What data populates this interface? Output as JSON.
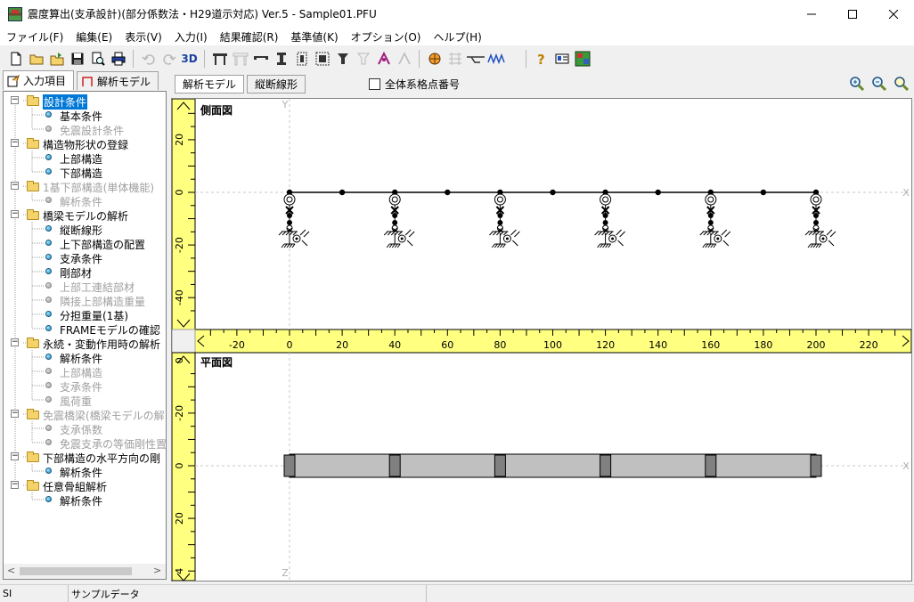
{
  "window": {
    "title": "震度算出(支承設計)(部分係数法・H29道示対応) Ver.5 - Sample01.PFU",
    "minimize_icon": "minimize-icon",
    "maximize_icon": "maximize-icon",
    "close_icon": "close-icon"
  },
  "menu": [
    {
      "label": "ファイル(F)"
    },
    {
      "label": "編集(E)"
    },
    {
      "label": "表示(V)"
    },
    {
      "label": "入力(I)"
    },
    {
      "label": "結果確認(R)"
    },
    {
      "label": "基準値(K)"
    },
    {
      "label": "オプション(O)"
    },
    {
      "label": "ヘルプ(H)"
    }
  ],
  "toolbar": {
    "view3d_label": "3D",
    "icons": [
      "new-file-icon",
      "open-folder-icon",
      "open-sample-icon",
      "save-icon",
      "print-preview-icon",
      "print-icon",
      "undo-icon",
      "redo-icon",
      "bridge-frame-icon",
      "bridge-frame-2-icon",
      "girder-icon",
      "pier-icon",
      "pier-2-icon",
      "bearing-icon",
      "bearing-2-icon",
      "column-icon",
      "column-2-icon",
      "crane-icon",
      "crane-2-icon",
      "calc-icon",
      "grid-icon",
      "level-icon",
      "spring-icon",
      "help-icon",
      "id-card-icon",
      "map-icon"
    ]
  },
  "left_tabs": [
    {
      "label": "入力項目",
      "icon": "input-items-icon",
      "active": true
    },
    {
      "label": "解析モデル",
      "icon": "analysis-model-icon",
      "active": false
    }
  ],
  "tree": [
    {
      "level": 0,
      "label": "設計条件",
      "type": "folder",
      "enabled": true,
      "selected": true
    },
    {
      "level": 1,
      "label": "基本条件",
      "type": "item",
      "enabled": true
    },
    {
      "level": 1,
      "label": "免震設計条件",
      "type": "item",
      "enabled": false
    },
    {
      "level": 0,
      "label": "構造物形状の登録",
      "type": "folder",
      "enabled": true
    },
    {
      "level": 1,
      "label": "上部構造",
      "type": "item",
      "enabled": true
    },
    {
      "level": 1,
      "label": "下部構造",
      "type": "item",
      "enabled": true
    },
    {
      "level": 0,
      "label": "1基下部構造(単体機能)",
      "type": "folder",
      "enabled": false
    },
    {
      "level": 1,
      "label": "解析条件",
      "type": "item",
      "enabled": false
    },
    {
      "level": 0,
      "label": "橋梁モデルの解析",
      "type": "folder",
      "enabled": true
    },
    {
      "level": 1,
      "label": "縦断線形",
      "type": "item",
      "enabled": true
    },
    {
      "level": 1,
      "label": "上下部構造の配置",
      "type": "item",
      "enabled": true
    },
    {
      "level": 1,
      "label": "支承条件",
      "type": "item",
      "enabled": true
    },
    {
      "level": 1,
      "label": "剛部材",
      "type": "item",
      "enabled": true
    },
    {
      "level": 1,
      "label": "上部工連結部材",
      "type": "item",
      "enabled": false
    },
    {
      "level": 1,
      "label": "隣接上部構造重量",
      "type": "item",
      "enabled": false
    },
    {
      "level": 1,
      "label": "分担重量(1基)",
      "type": "item",
      "enabled": true
    },
    {
      "level": 1,
      "label": "FRAMEモデルの確認",
      "type": "item",
      "enabled": true
    },
    {
      "level": 0,
      "label": "永続・変動作用時の解析",
      "type": "folder",
      "enabled": true
    },
    {
      "level": 1,
      "label": "解析条件",
      "type": "item",
      "enabled": true
    },
    {
      "level": 1,
      "label": "上部構造",
      "type": "item",
      "enabled": false
    },
    {
      "level": 1,
      "label": "支承条件",
      "type": "item",
      "enabled": false
    },
    {
      "level": 1,
      "label": "風荷重",
      "type": "item",
      "enabled": false
    },
    {
      "level": 0,
      "label": "免震橋梁(橋梁モデルの解",
      "type": "folder",
      "enabled": false
    },
    {
      "level": 1,
      "label": "支承係数",
      "type": "item",
      "enabled": false
    },
    {
      "level": 1,
      "label": "免震支承の等価剛性置",
      "type": "item",
      "enabled": false
    },
    {
      "level": 0,
      "label": "下部構造の水平方向の剛",
      "type": "folder",
      "enabled": true
    },
    {
      "level": 1,
      "label": "解析条件",
      "type": "item",
      "enabled": true
    },
    {
      "level": 0,
      "label": "任意骨組解析",
      "type": "folder",
      "enabled": true
    },
    {
      "level": 1,
      "label": "解析条件",
      "type": "item",
      "enabled": true
    }
  ],
  "right_tabs": [
    {
      "label": "解析モデル",
      "active": true
    },
    {
      "label": "縦断線形",
      "active": false
    }
  ],
  "checkbox": {
    "label": "全体系格点番号",
    "checked": false
  },
  "zoom_icons": [
    "zoom-in-icon",
    "zoom-out-icon",
    "zoom-fit-icon"
  ],
  "side_view": {
    "title": "側面図",
    "y_ruler_ticks": [
      20,
      0,
      -20,
      -40
    ],
    "x_ruler_ticks": [
      -20,
      0,
      20,
      40,
      60,
      80,
      100,
      120,
      140,
      160,
      180,
      200,
      220
    ],
    "y_axis_name": "Y",
    "x_axis_name": "X",
    "supports_x": [
      0,
      40,
      80,
      120,
      160,
      200
    ],
    "girder_nodes_x": [
      0,
      20,
      40,
      60,
      80,
      100,
      120,
      140,
      160,
      180,
      200
    ]
  },
  "plan_view": {
    "title": "平面図",
    "y_ruler_ticks": [
      0,
      -20,
      0,
      20,
      4
    ],
    "x_axis_name": "X",
    "z_axis_name": "Z",
    "deck_x_range": [
      0,
      200
    ],
    "piers_x": [
      0,
      40,
      80,
      120,
      160,
      200
    ]
  },
  "colors": {
    "ruler": "#ffff80",
    "selection": "#0078d7",
    "deck": "#c0c0c0",
    "pier": "#808080"
  },
  "status": {
    "unit": "SI",
    "message": "サンプルデータ"
  }
}
